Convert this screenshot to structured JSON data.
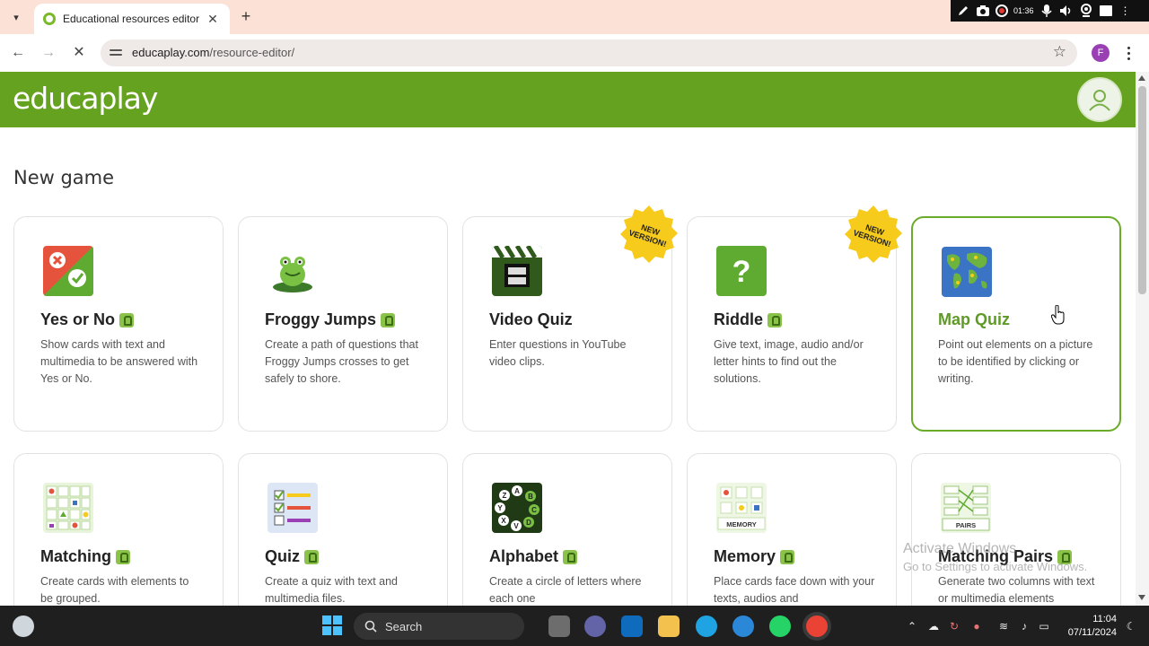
{
  "browser": {
    "tab_title": "Educational resources editor",
    "new_tab_symbol": "+",
    "url_host": "educaplay.com",
    "url_path": "/resource-editor/",
    "profile_initial": "F",
    "recorder_time": "01:36"
  },
  "header": {
    "logo_text": "educaplay"
  },
  "page": {
    "section_title": "New game"
  },
  "cards": [
    {
      "title": "Yes or No",
      "desc": "Show cards with text and multimedia to be answered with Yes or No.",
      "icon": "yes-no-icon"
    },
    {
      "title": "Froggy Jumps",
      "desc": "Create a path of questions that Froggy Jumps crosses to get safely to shore.",
      "icon": "frog-icon"
    },
    {
      "title": "Video Quiz",
      "desc": "Enter questions in YouTube video clips.",
      "icon": "clapperboard-icon",
      "badge": "NEW VERSION!"
    },
    {
      "title": "Riddle",
      "desc": "Give text, image, audio and/or letter hints to find out the solutions.",
      "icon": "question-icon",
      "badge": "NEW VERSION!"
    },
    {
      "title": "Map Quiz",
      "desc": "Point out elements on a picture to be identified by clicking or writing.",
      "icon": "world-map-icon"
    },
    {
      "title": "Matching",
      "desc": "Create cards with elements to be grouped.",
      "icon": "grid-shapes-icon"
    },
    {
      "title": "Quiz",
      "desc": "Create a quiz with text and multimedia files.",
      "icon": "checklist-icon"
    },
    {
      "title": "Alphabet",
      "desc": "Create a circle of letters where each one",
      "icon": "letter-circle-icon"
    },
    {
      "title": "Memory",
      "desc": "Place cards face down with your texts, audios and",
      "icon": "memory-cards-icon",
      "icon_label": "MEMORY"
    },
    {
      "title": "Matching Pairs",
      "desc": "Generate two columns with text or multimedia elements",
      "icon": "pairs-icon",
      "icon_label": "PAIRS"
    }
  ],
  "watermark": {
    "line1": "Activate Windows",
    "line2": "Go to Settings to activate Windows."
  },
  "taskbar": {
    "search_label": "Search",
    "time": "11:04",
    "date": "07/11/2024"
  }
}
